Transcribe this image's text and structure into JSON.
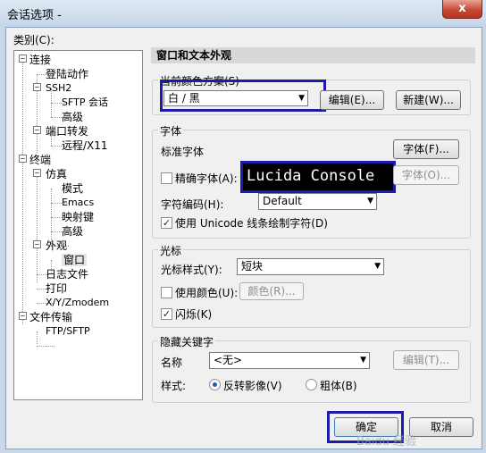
{
  "window": {
    "title": "会话选项 -",
    "close_glyph": "x"
  },
  "category_label": "类别(C):",
  "tree": {
    "connection": "连接",
    "login_actions": "登陆动作",
    "ssh2": "SSH2",
    "sftp_session": "SFTP 会话",
    "advanced_ssh": "高级",
    "port_forward": "端口转发",
    "remote_x11": "远程/X11",
    "terminal": "终端",
    "emulation": "仿真",
    "modes": "模式",
    "emacs": "Emacs",
    "mapped_keys": "映射键",
    "advanced_emu": "高级",
    "appearance": "外观",
    "window_item": "窗口",
    "log_file": "日志文件",
    "print": "打印",
    "xyzmodem": "X/Y/Zmodem",
    "file_transfer": "文件传输",
    "ftp_sftp": "FTP/SFTP"
  },
  "panel_title": "窗口和文本外观",
  "color_scheme": {
    "label": "当前颜色方案(S)",
    "value": "白 / 黑",
    "edit_button": "编辑(E)...",
    "new_button": "新建(W)..."
  },
  "font": {
    "group": "字体",
    "std_label": "标准字体",
    "std_value": "Lucida Console",
    "font_button": "字体(F)...",
    "precise_label": "精确字体(A):",
    "precise_button": "字体(O)...",
    "encoding_label": "字符编码(H):",
    "encoding_value": "Default",
    "unicode_label": "使用 Unicode 线条绘制字符(D)"
  },
  "cursor": {
    "group": "光标",
    "style_label": "光标样式(Y):",
    "style_value": "短块",
    "use_color_label": "使用颜色(U):",
    "color_button": "颜色(R)...",
    "blink_label": "闪烁(K)"
  },
  "hidden_key": {
    "group": "隐藏关键字",
    "name_label": "名称",
    "name_value": "<无>",
    "edit_button": "编辑(T)...",
    "style_label": "样式:",
    "radio_reverse": "反转影像(V)",
    "radio_bold": "粗体(B)"
  },
  "buttons": {
    "ok": "确定",
    "cancel": "取消"
  },
  "watermark": "Baidu 经验"
}
